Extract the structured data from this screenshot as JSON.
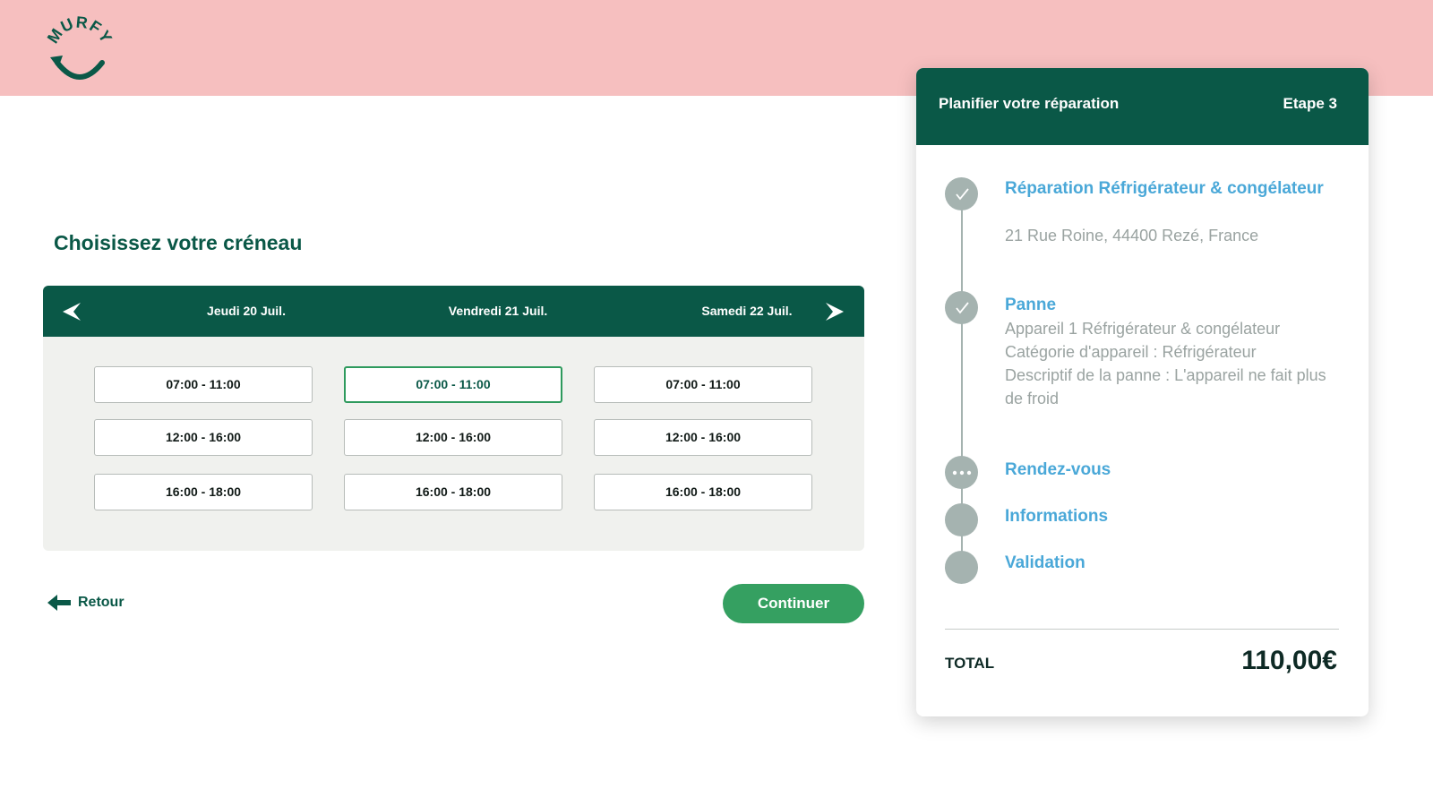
{
  "brand": {
    "logo_text": "MURFY"
  },
  "page": {
    "title": "Choisissez votre créneau"
  },
  "calendar": {
    "days": [
      {
        "label": "Jeudi 20 Juil.",
        "slots": [
          "07:00 - 11:00",
          "12:00 - 16:00",
          "16:00 - 18:00"
        ]
      },
      {
        "label": "Vendredi 21 Juil.",
        "slots": [
          "07:00 - 11:00",
          "12:00 - 16:00",
          "16:00 - 18:00"
        ]
      },
      {
        "label": "Samedi 22 Juil.",
        "slots": [
          "07:00 - 11:00",
          "12:00 - 16:00",
          "16:00 - 18:00"
        ]
      }
    ],
    "selected": {
      "day": 1,
      "slot": 0
    }
  },
  "actions": {
    "back_label": "Retour",
    "continue_label": "Continuer"
  },
  "summary": {
    "title": "Planifier votre réparation",
    "step_label": "Etape 3",
    "steps": [
      {
        "title": "Réparation Réfrigérateur & congélateur",
        "status": "done",
        "details": [
          "21 Rue Roine, 44400 Rezé, France"
        ]
      },
      {
        "title": "Panne",
        "status": "done",
        "details": [
          "Appareil 1 Réfrigérateur & congélateur",
          "Catégorie d'appareil : Réfrigérateur",
          "Descriptif de la panne : L'appareil ne fait plus  de froid"
        ]
      },
      {
        "title": "Rendez-vous",
        "status": "current",
        "details": []
      },
      {
        "title": "Informations",
        "status": "pending",
        "details": []
      },
      {
        "title": "Validation",
        "status": "pending",
        "details": []
      }
    ],
    "total_label": "TOTAL",
    "total_value": "110,00€"
  },
  "colors": {
    "band": "#f6bfbf",
    "primary": "#0a5847",
    "accent_green": "#35a061",
    "link_blue": "#4aa8d8",
    "muted": "#a5b3b0"
  }
}
